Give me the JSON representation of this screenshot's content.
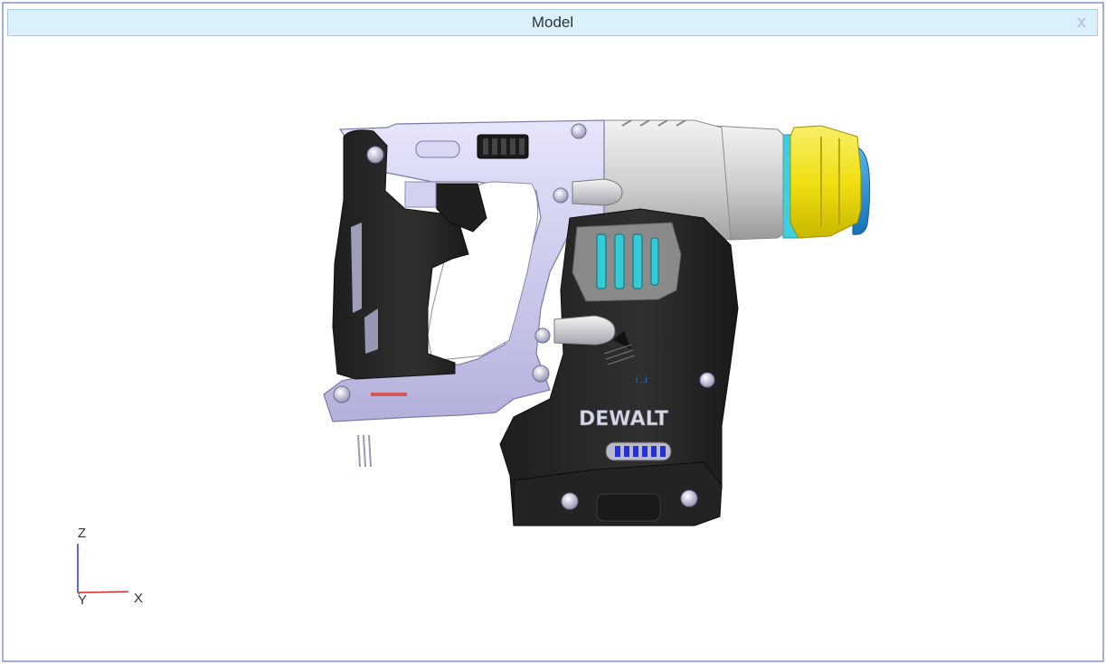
{
  "window": {
    "title": "Model",
    "close_glyph": "x"
  },
  "model": {
    "brand_text": "DEWALT"
  },
  "triad": {
    "z_label": "Z",
    "y_label": "Y",
    "x_label": "X"
  },
  "colors": {
    "titlebar_bg": "#daf1fc",
    "window_border": "#9fb0d8",
    "body_dark": "#2a2a2a",
    "frame_lavender": "#c9c8ec",
    "collar_yellow": "#f2e21b",
    "chuck_blue": "#1f8fd0",
    "vent_cyan": "#33cbd6"
  }
}
